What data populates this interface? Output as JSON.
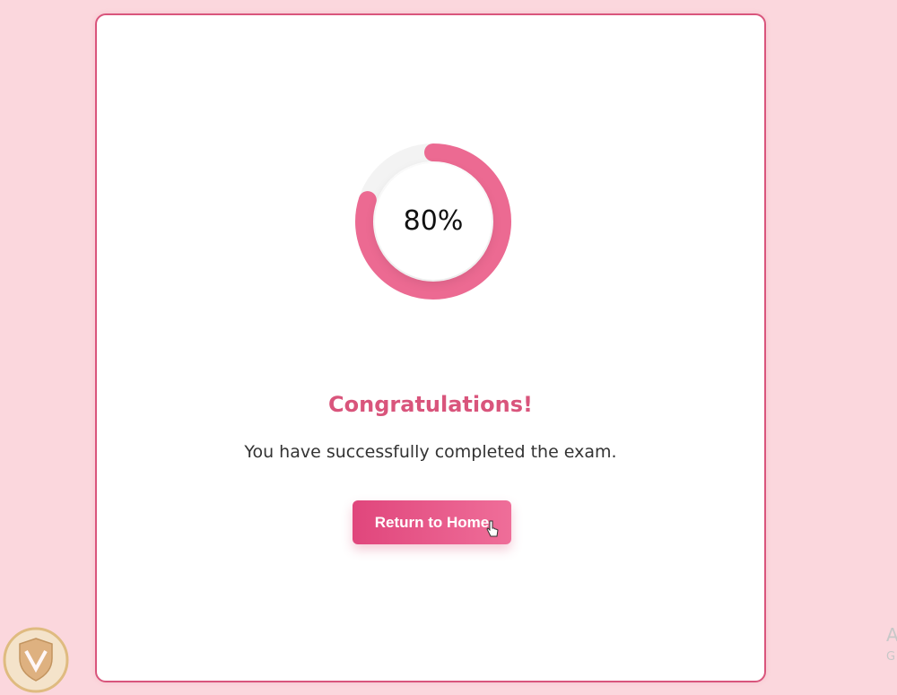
{
  "result": {
    "percentage_label": "80%",
    "progress_fraction": 0.8,
    "title": "Congratulations!",
    "message": "You have successfully completed the exam.",
    "home_button_label": "Return to Home"
  },
  "edge": {
    "a_char": "A",
    "g_char": "G"
  },
  "colors": {
    "accent": "#d9557c",
    "ring": "#ec6a92",
    "ring_track": "#f3f3f3",
    "background": "#fbd7dd"
  },
  "icons": {
    "cursor": "hand-pointer-icon",
    "watermark": "shield-logo-icon"
  }
}
